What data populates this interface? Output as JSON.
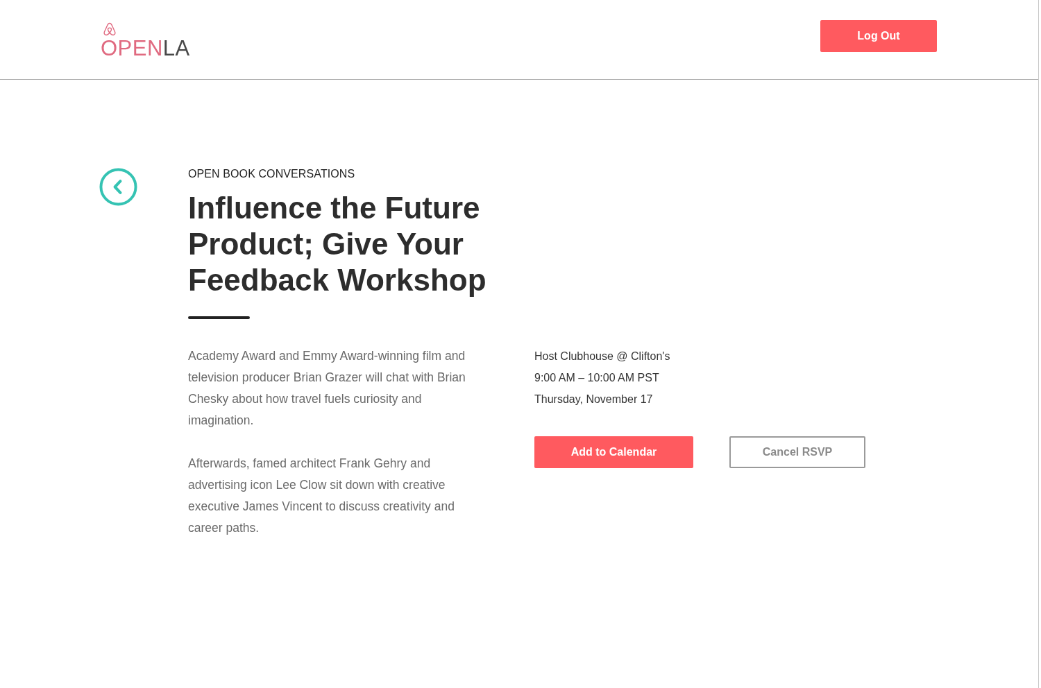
{
  "header": {
    "logo": {
      "parts": [
        {
          "text": "OPEN",
          "color": "#e06a80"
        },
        {
          "text": "LA",
          "color": "#484848"
        }
      ]
    },
    "logout_button": "Log Out"
  },
  "event": {
    "category": "OPEN BOOK CONVERSATIONS",
    "title": "Influence the Future Product; Give Your Feedback Workshop",
    "description": [
      "Academy Award and Emmy Award-winning film and television producer Brian Grazer will chat with Brian Chesky about how travel fuels curiosity and imagination.",
      "Afterwards, famed architect Frank Gehry and advertising icon Lee Clow sit down with creative executive James Vincent to discuss creativity and career paths."
    ],
    "details": [
      "Host Clubhouse @ Clifton's",
      "9:00 AM – 10:00 AM PST",
      "Thursday, November 17"
    ],
    "actions": [
      {
        "label": "Add to Calendar",
        "kind": "primary"
      },
      {
        "label": "Cancel RSVP",
        "kind": "secondary"
      }
    ]
  }
}
